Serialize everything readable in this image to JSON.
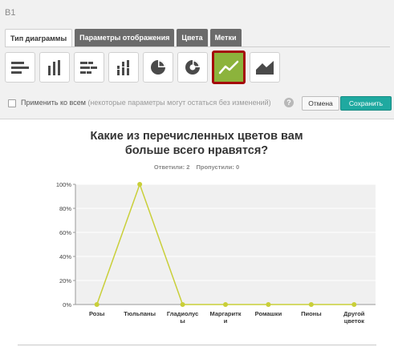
{
  "header": {
    "label": "B1"
  },
  "tabs": [
    {
      "label": "Тип диаграммы",
      "active": true
    },
    {
      "label": "Параметры отображения",
      "active": false
    },
    {
      "label": "Цвета",
      "active": false
    },
    {
      "label": "Метки",
      "active": false
    }
  ],
  "chart_types": [
    {
      "icon": "horizontal-bar-icon",
      "selected": false
    },
    {
      "icon": "vertical-bar-icon",
      "selected": false
    },
    {
      "icon": "stacked-horizontal-bar-icon",
      "selected": false
    },
    {
      "icon": "stacked-vertical-bar-icon",
      "selected": false
    },
    {
      "icon": "pie-icon",
      "selected": false
    },
    {
      "icon": "donut-icon",
      "selected": false
    },
    {
      "icon": "line-icon",
      "selected": true
    },
    {
      "icon": "area-icon",
      "selected": false
    }
  ],
  "apply": {
    "label": "Применить ко всем",
    "note": "(некоторые параметры могут остаться без изменений)",
    "help": "?",
    "checked": false
  },
  "buttons": {
    "cancel": "Отмена",
    "save": "Сохранить"
  },
  "colors": {
    "accent": "#1fa9a0",
    "selected_type": "#8cb33c",
    "selected_border": "#a40b0b",
    "line": "#c9cf39"
  },
  "chart_data": {
    "type": "line",
    "title_line1": "Какие из перечисленных цветов вам",
    "title_line2": "больше всего нравятся?",
    "answered_label": "Ответили: 2",
    "skipped_label": "Пропустили: 0",
    "categories": [
      [
        "Розы"
      ],
      [
        "Тюльпаны"
      ],
      [
        "Гладиолус",
        "ы"
      ],
      [
        "Маргаритк",
        "и"
      ],
      [
        "Ромашки"
      ],
      [
        "Пионы"
      ],
      [
        "Другой",
        "цветок"
      ]
    ],
    "values": [
      0,
      100,
      0,
      0,
      0,
      0,
      0
    ],
    "ylim": [
      0,
      100
    ],
    "yticks": [
      "0%",
      "20%",
      "40%",
      "60%",
      "80%",
      "100%"
    ],
    "grid": true,
    "legend": "none"
  }
}
